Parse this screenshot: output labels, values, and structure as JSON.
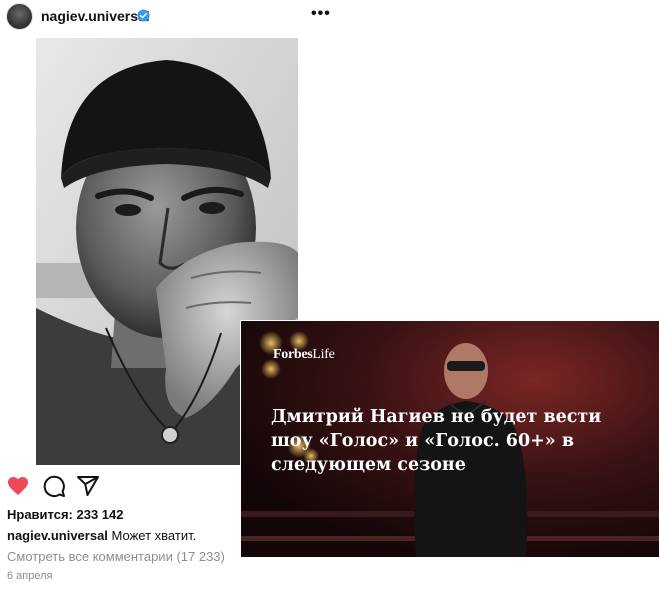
{
  "post": {
    "username": "nagiev.universal",
    "likes_text": "Нравится: 233 142",
    "caption_user": "nagiev.universal",
    "caption_text": "Может хватит.",
    "comments_link": "Смотреть все комментарии (17 233)",
    "date": "6 апреля",
    "icons": [
      "avatar",
      "verified-badge-icon",
      "more-icon",
      "heart-icon",
      "comment-icon",
      "share-icon"
    ],
    "colors": {
      "like": "#ed4956",
      "verified": "#3897f0",
      "secondary_text": "#8e8e8e"
    }
  },
  "forbes_card": {
    "logo_main": "Forbes",
    "logo_sub": "Life",
    "headline_lines": [
      "Дмитрий Нагиев не будет вести",
      "шоу «Голос» и «Голос. 60+» в",
      "следующем сезоне"
    ],
    "colors": {
      "background": "#2a0e10",
      "text": "#ffffff"
    }
  }
}
